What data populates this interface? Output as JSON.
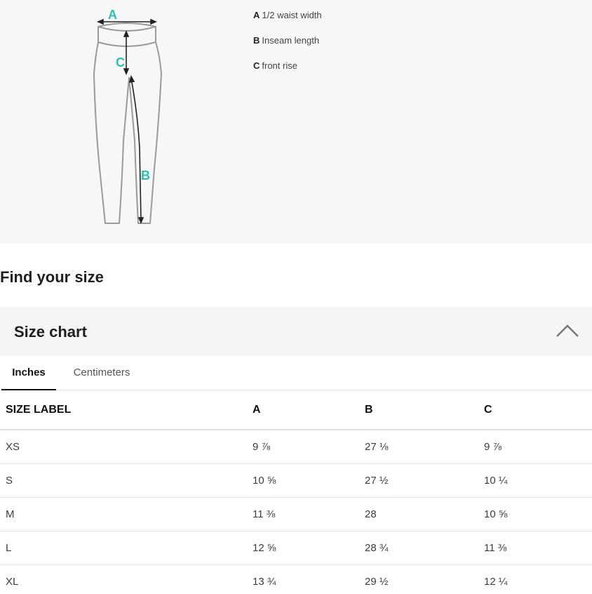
{
  "diagram": {
    "labels": {
      "a": "A",
      "b": "B",
      "c": "C"
    },
    "colors": {
      "letter": "#2bbfb3",
      "outline": "#9a9a9a",
      "arrow": "#222222"
    }
  },
  "legend": [
    {
      "key": "A",
      "text": "1/2 waist width"
    },
    {
      "key": "B",
      "text": "Inseam length"
    },
    {
      "key": "C",
      "text": "front rise"
    }
  ],
  "find_size_title": "Find your size",
  "size_chart": {
    "title": "Size chart",
    "toggle_icon": "chevron-up-icon",
    "tabs": [
      {
        "label": "Inches",
        "active": true
      },
      {
        "label": "Centimeters",
        "active": false
      }
    ],
    "headers": [
      "SIZE LABEL",
      "A",
      "B",
      "C"
    ],
    "rows": [
      [
        "XS",
        "9 ⅞",
        "27 ⅛",
        "9 ⅞"
      ],
      [
        "S",
        "10 ⅝",
        "27 ½",
        "10 ¼"
      ],
      [
        "M",
        "11 ⅜",
        "28",
        "10 ⅝"
      ],
      [
        "L",
        "12 ⅝",
        "28 ¾",
        "11 ⅜"
      ],
      [
        "XL",
        "13 ¾",
        "29 ½",
        "12 ¼"
      ]
    ]
  }
}
